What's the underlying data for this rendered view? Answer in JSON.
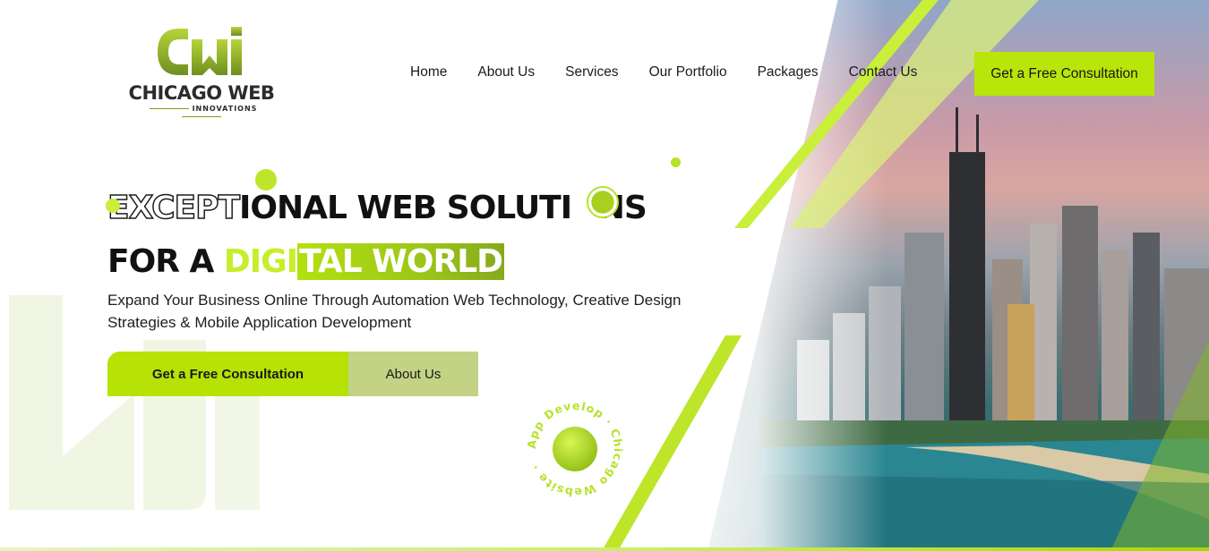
{
  "logo": {
    "title": "CHICAGO WEB",
    "subtitle": "INNOVATIONS",
    "mark_icon": "cwi-logo-icon"
  },
  "nav": {
    "items": [
      {
        "label": "Home"
      },
      {
        "label": "About Us"
      },
      {
        "label": "Services"
      },
      {
        "label": "Our Portfolio"
      },
      {
        "label": "Packages"
      },
      {
        "label": "Contact Us"
      }
    ],
    "cta_label": "Get a Free Consultation"
  },
  "hero": {
    "line1_outline": "EXCEPT",
    "line1_solid": "IONAL WEB SOLUTI",
    "line1_o": "O",
    "line1_end": "NS",
    "line2_solid": "FOR A ",
    "line2_green": "DIGI",
    "line2_box": "TAL WORLD",
    "subtitle": "Expand Your Business Online Through Automation Web Technology, Creative Design Strategies & Mobile Application Development",
    "primary_button": "Get a Free Consultation",
    "secondary_button": "About Us"
  },
  "badge": {
    "circular_text": "App Develop · Chicago Website · "
  },
  "colors": {
    "accent": "#b8e60a",
    "accent_dark": "#86a91c",
    "secondary_button": "#c3d284",
    "text": "#111111"
  }
}
